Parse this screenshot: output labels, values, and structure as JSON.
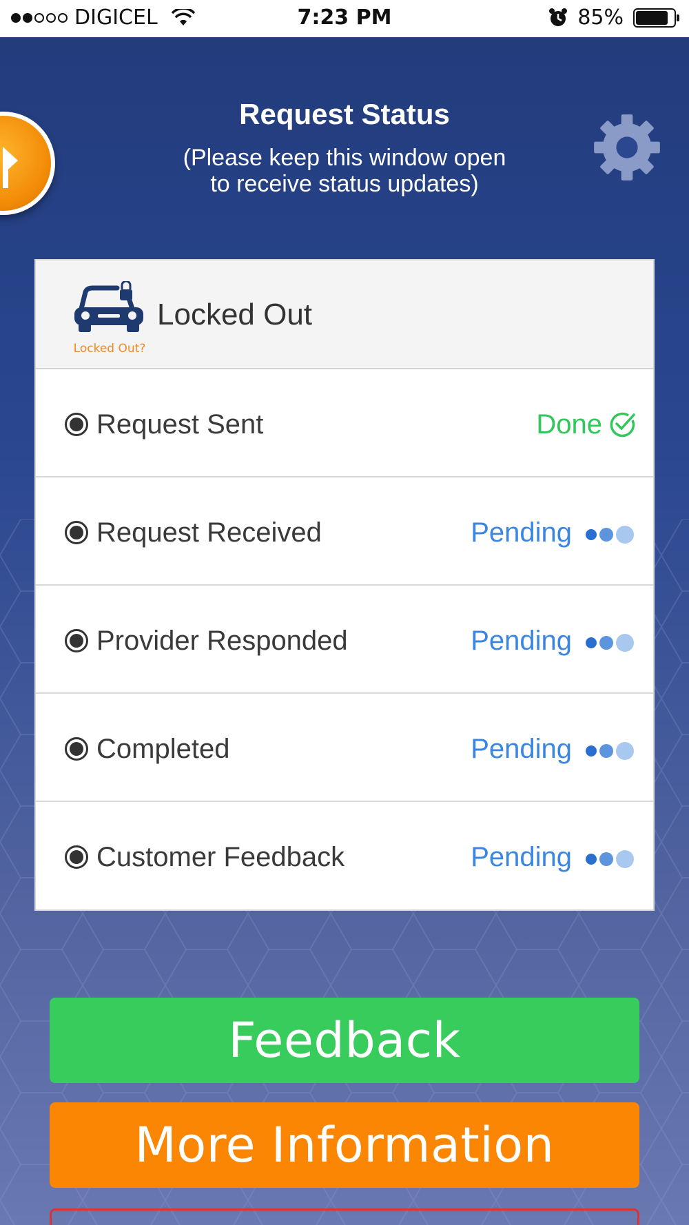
{
  "status_bar": {
    "carrier": "DIGICEL",
    "time": "7:23 PM",
    "battery": "85%"
  },
  "header": {
    "title": "Request Status",
    "subtitle": "(Please keep this window open\nto receive status updates)"
  },
  "service": {
    "icon_caption": "Locked Out?",
    "title": "Locked Out"
  },
  "steps": [
    {
      "label": "Request Sent",
      "status": "Done"
    },
    {
      "label": "Request Received",
      "status": "Pending"
    },
    {
      "label": "Provider Responded",
      "status": "Pending"
    },
    {
      "label": "Completed",
      "status": "Pending"
    },
    {
      "label": "Customer Feedback",
      "status": "Pending"
    }
  ],
  "buttons": {
    "feedback": "Feedback",
    "more_info": "More Information"
  },
  "colors": {
    "done": "#31c75b",
    "pending": "#3b86e0",
    "feedback_button": "#37cc5b",
    "info_button": "#fb8604"
  }
}
